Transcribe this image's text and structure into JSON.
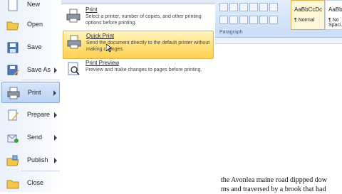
{
  "office_menu": {
    "items": [
      {
        "label": "New",
        "icon": "new-document-icon",
        "has_arrow": false
      },
      {
        "label": "Open",
        "icon": "folder-open-icon",
        "has_arrow": false
      },
      {
        "label": "Save",
        "icon": "floppy-disk-icon",
        "has_arrow": false
      },
      {
        "label": "Save As",
        "icon": "save-as-icon",
        "has_arrow": true
      },
      {
        "label": "Print",
        "icon": "printer-icon",
        "has_arrow": true
      },
      {
        "label": "Prepare",
        "icon": "prepare-icon",
        "has_arrow": true
      },
      {
        "label": "Send",
        "icon": "send-icon",
        "has_arrow": true
      },
      {
        "label": "Publish",
        "icon": "publish-icon",
        "has_arrow": true
      },
      {
        "label": "Close",
        "icon": "close-folder-icon",
        "has_arrow": false
      }
    ],
    "selected": "Print"
  },
  "print_submenu": {
    "items": [
      {
        "title": "Print",
        "description": "Select a printer, number of copies, and other printing options before printing.",
        "icon": "printer-icon"
      },
      {
        "title": "Quick Print",
        "description": "Send the document directly to the default printer without making changes.",
        "icon": "quick-print-icon"
      },
      {
        "title": "Print Preview",
        "description": "Preview and make changes to pages before printing.",
        "icon": "print-preview-icon"
      }
    ],
    "highlighted": "Quick Print"
  },
  "ribbon": {
    "styles": [
      {
        "sample": "AaBbCcDc",
        "name": "¶ Normal"
      },
      {
        "sample": "AaBbCcDc",
        "name": "¶ No Spaci..."
      }
    ],
    "group_label": "Paragraph"
  },
  "document": {
    "lines": [
      "the Avonlea maine road dippped dow",
      "ms and traversed by a brook that had"
    ]
  },
  "colors": {
    "highlight": "#ffd24f",
    "menu_bg": "#eaf1fb",
    "ribbon_bg": "#cddff7"
  }
}
